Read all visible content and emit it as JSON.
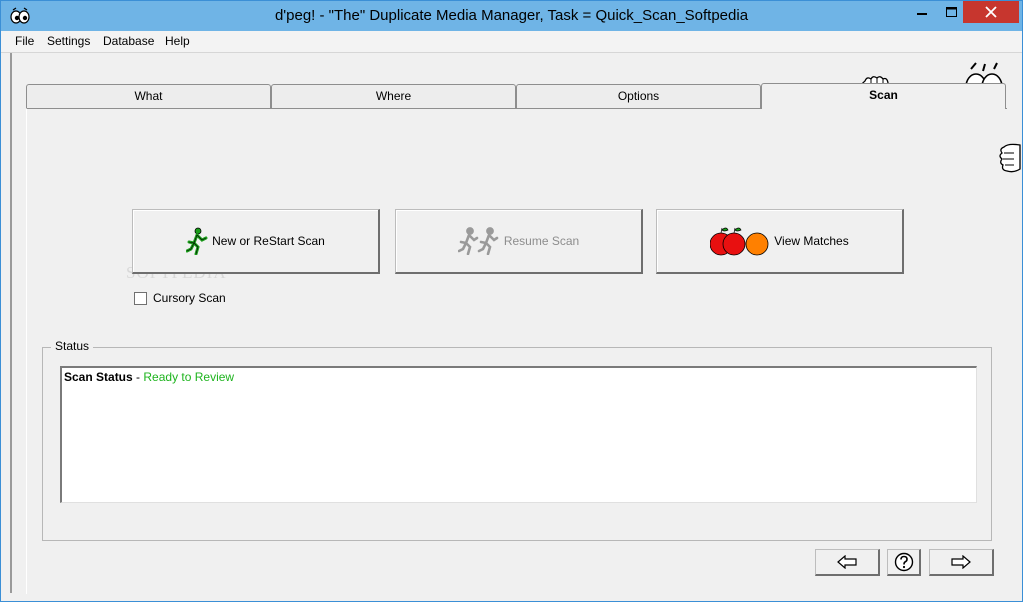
{
  "window": {
    "title": "d'peg! - \"The\" Duplicate Media Manager, Task = Quick_Scan_Softpedia"
  },
  "menu": [
    "File",
    "Settings",
    "Database",
    "Help"
  ],
  "tabs": [
    {
      "label": "What",
      "active": false
    },
    {
      "label": "Where",
      "active": false
    },
    {
      "label": "Options",
      "active": false
    },
    {
      "label": "Scan",
      "active": true
    }
  ],
  "buttons": {
    "new_scan": "New or ReStart Scan",
    "resume_scan": "Resume Scan",
    "view_matches": "View Matches"
  },
  "cursory_scan": {
    "label": "Cursory Scan",
    "checked": false
  },
  "status": {
    "group_label": "Status",
    "line_label": "Scan Status",
    "separator": " - ",
    "value": "Ready to Review"
  },
  "watermark": "SOFTPEDIA",
  "icons": {
    "app": "dpeg-eyes-icon",
    "back": "arrow-left-icon",
    "help": "help-question-icon",
    "forward": "arrow-right-icon"
  },
  "colors": {
    "title_bar": "#6fb4e6",
    "close_button": "#c7362e",
    "status_ready": "#1eb41e",
    "runner_active": "#1a9e1a",
    "apple_red": "#e81010",
    "orange": "#ff8000"
  }
}
